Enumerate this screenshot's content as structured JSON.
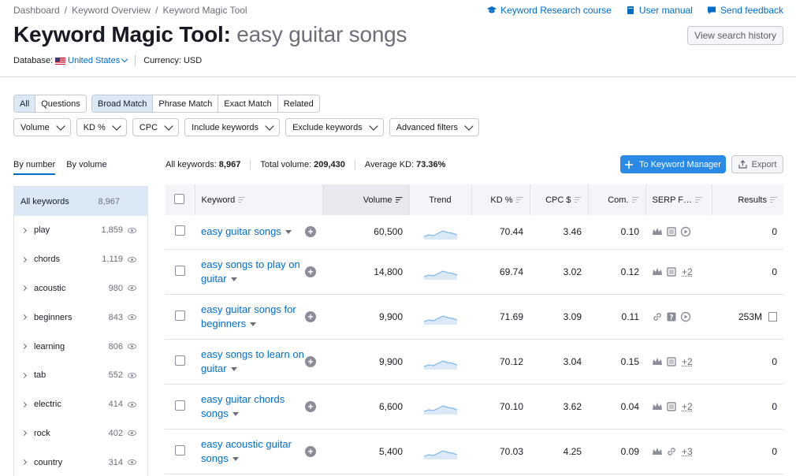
{
  "breadcrumb": [
    "Dashboard",
    "Keyword Overview",
    "Keyword Magic Tool"
  ],
  "toplinks": [
    "Keyword Research course",
    "User manual",
    "Send feedback"
  ],
  "title": {
    "tool": "Keyword Magic Tool:",
    "query": "easy guitar songs"
  },
  "history_button": "View search history",
  "database": {
    "label": "Database:",
    "value": "United States",
    "currency_label": "Currency: USD"
  },
  "question_tabs": [
    "All",
    "Questions"
  ],
  "match_tabs": [
    "Broad Match",
    "Phrase Match",
    "Exact Match",
    "Related"
  ],
  "filters": [
    "Volume",
    "KD %",
    "CPC",
    "Include keywords",
    "Exclude keywords",
    "Advanced filters"
  ],
  "group_toggle": [
    "By number",
    "By volume"
  ],
  "sidebar": {
    "all": {
      "label": "All keywords",
      "count": "8,967"
    },
    "items": [
      {
        "label": "play",
        "count": "1,859"
      },
      {
        "label": "chords",
        "count": "1,119"
      },
      {
        "label": "acoustic",
        "count": "980"
      },
      {
        "label": "beginners",
        "count": "843"
      },
      {
        "label": "learning",
        "count": "806"
      },
      {
        "label": "tab",
        "count": "552"
      },
      {
        "label": "electric",
        "count": "414"
      },
      {
        "label": "rock",
        "count": "402"
      },
      {
        "label": "country",
        "count": "314"
      }
    ]
  },
  "stats": {
    "all_label": "All keywords:",
    "all_value": "8,967",
    "volume_label": "Total volume:",
    "volume_value": "209,430",
    "kd_label": "Average KD:",
    "kd_value": "73.36%"
  },
  "actions": {
    "keyword_manager": "To Keyword Manager",
    "export": "Export"
  },
  "table": {
    "headers": [
      "Keyword",
      "Volume",
      "Trend",
      "KD %",
      "CPC $",
      "Com.",
      "SERP F…",
      "Results"
    ],
    "rows": [
      {
        "keyword": [
          "easy guitar songs"
        ],
        "volume": "60,500",
        "kd": "70.44",
        "cpc": "3.46",
        "com": "0.10",
        "serp": [
          "crown-icon",
          "reviews-icon",
          "video-icon"
        ],
        "serp_more": "",
        "results": "0"
      },
      {
        "keyword": [
          "easy songs to play on",
          "guitar"
        ],
        "volume": "14,800",
        "kd": "69.74",
        "cpc": "3.02",
        "com": "0.12",
        "serp": [
          "crown-icon",
          "reviews-icon"
        ],
        "serp_more": "+2",
        "results": "0"
      },
      {
        "keyword": [
          "easy guitar songs for",
          "beginners"
        ],
        "volume": "9,900",
        "kd": "71.69",
        "cpc": "3.09",
        "com": "0.11",
        "serp": [
          "link-icon",
          "question-icon",
          "video-icon"
        ],
        "serp_more": "",
        "results": "253M"
      },
      {
        "keyword": [
          "easy songs to learn on",
          "guitar"
        ],
        "volume": "9,900",
        "kd": "70.12",
        "cpc": "3.04",
        "com": "0.15",
        "serp": [
          "crown-icon",
          "reviews-icon"
        ],
        "serp_more": "+2",
        "results": "0"
      },
      {
        "keyword": [
          "easy guitar chords",
          "songs"
        ],
        "volume": "6,600",
        "kd": "70.10",
        "cpc": "3.62",
        "com": "0.04",
        "serp": [
          "crown-icon",
          "reviews-icon"
        ],
        "serp_more": "+2",
        "results": "0"
      },
      {
        "keyword": [
          "easy acoustic guitar",
          "songs"
        ],
        "volume": "5,400",
        "kd": "70.03",
        "cpc": "4.25",
        "com": "0.09",
        "serp": [
          "crown-icon",
          "link-icon"
        ],
        "serp_more": "+3",
        "results": "0"
      }
    ]
  },
  "colors": {
    "accent": "#006dca",
    "primary_button": "#2b8ae6",
    "selected_bg": "#dbe9f7",
    "trend": "#7fb8ec"
  }
}
